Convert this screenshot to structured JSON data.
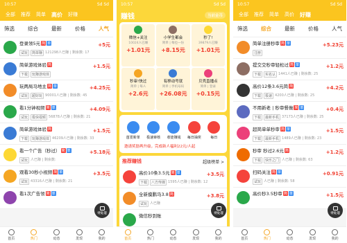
{
  "status": {
    "time": "10:57",
    "right": "Sd Sd"
  },
  "p1": {
    "tabs": [
      "全部",
      "推荐",
      "简单",
      "高价",
      "好赚"
    ],
    "active": 3,
    "filter": "筛选",
    "sub": [
      "综合",
      "最新",
      "价格",
      "人气"
    ],
    "subon": 3,
    "items": [
      {
        "t": "登录领5元",
        "b": [
          "简",
          "单"
        ],
        "tag": "试玩",
        "m": "简单赚",
        "s": "121298人已赚 | 剩余数: 17",
        "p": "+5元",
        "c": "#2aa84a"
      },
      {
        "t": "简单游戏体验",
        "b": [
          "简"
        ],
        "tag": "下载",
        "m": "玩赚游戏体",
        "s": "",
        "p": "+1.5元",
        "c": "#3a7bd5"
      },
      {
        "t": "玩两局马地主",
        "b": [
          "简",
          "单"
        ],
        "tag": "试玩",
        "m": "超好玩",
        "s": "90001人已赚 | 剩余数: 45",
        "p": "+4.25元",
        "c": "#f28c28"
      },
      {
        "t": "看1分钟视频",
        "b": [
          "简",
          "单"
        ],
        "tag": "试玩",
        "m": "极快视频",
        "s": "56878人已赚 | 剩余数: 21",
        "p": "+4.09元",
        "c": "#2aa84a"
      },
      {
        "t": "简单游戏体验",
        "b": [
          "简"
        ],
        "tag": "下载",
        "m": "玩赚游戏体",
        "s": "46209人已赚 | 剩余数: 33",
        "p": "+1.5元",
        "c": "#3a7bd5"
      },
      {
        "t": "看一个广告（秒过）",
        "b": [
          "简",
          "单"
        ],
        "tag": "试玩",
        "m": "",
        "s": "人已赚 | 剩余数:",
        "p": "+5.18元",
        "c": "#fdd835"
      },
      {
        "t": "观看30秒小视频",
        "b": [
          "简",
          "单"
        ],
        "tag": "试玩",
        "m": "",
        "s": "43316人已赚 | 剩余数: 21",
        "p": "+3.5元",
        "c": "#f5a623"
      },
      {
        "t": "看1次广告领",
        "b": [
          "简",
          "单"
        ],
        "tag": "",
        "m": "",
        "s": "",
        "p": "",
        "c": "#8e44ad"
      }
    ]
  },
  "p2": {
    "title": "赚钱",
    "gold": "当前金币",
    "grid": [
      {
        "t": "微信+关注",
        "m": "10024人已赚",
        "p": "+1.01元",
        "c": "#2aa84a"
      },
      {
        "t": "小学生都会",
        "m": "简单 | 每位一份",
        "p": "+8.15元",
        "c": "#8d6e63"
      },
      {
        "t": "秒了!",
        "m": "39879人已赚",
        "p": "+1.01元",
        "c": "#fdd835"
      },
      {
        "t": "秒审!快过",
        "m": "简单 | 每人",
        "p": "+2.6元",
        "c": "#f5a623"
      },
      {
        "t": "有移动号就",
        "m": "简单 | 手机号码",
        "p": "+26.08元",
        "c": "#3a7bd5"
      },
      {
        "t": "贝壳直播点",
        "m": "简单 | 登录",
        "p": "+0.15元",
        "c": "#ec407a"
      }
    ],
    "icons": [
      {
        "l": "首发新单",
        "c": "#3b8cf0"
      },
      {
        "l": "极速审核",
        "c": "#3b8cf0"
      },
      {
        "l": "收徒赚钱",
        "c": "#3b8cf0"
      },
      {
        "l": "每日抽奖",
        "c": "#f5433c"
      },
      {
        "l": "每日",
        "c": "#f5433c"
      }
    ],
    "notice": "邀请奖励再升级，完成新人福利22元/人起",
    "rec": "推荐赚钱",
    "super": "超级榜单 >",
    "items": [
      {
        "t": "高价10条3.5元",
        "b": [
          "简",
          "单"
        ],
        "tag": "下载",
        "m": "八方传媒",
        "s": "1595人已赚 | 剩余数: 12",
        "p": "+3.5元",
        "c": "#f5433c"
      },
      {
        "t": "全新摸鹏马3.8",
        "b": [
          "简"
        ],
        "tag": "试玩",
        "m": "",
        "s": "人已赚",
        "p": "+3.8元",
        "c": "#f28c28"
      },
      {
        "t": "微信秒到账",
        "b": [],
        "tag": "",
        "m": "",
        "s": "",
        "p": "",
        "c": "#2aa84a"
      }
    ]
  },
  "p3": {
    "sub": [
      "筛选",
      "综合",
      "最新",
      "价格",
      "人气"
    ],
    "subon": 1,
    "items": [
      {
        "t": "简单注册秒审",
        "b": [
          "简",
          "单"
        ],
        "tag": "注册",
        "m": "",
        "s": "",
        "p": "+5.23元",
        "c": "#f28c28"
      },
      {
        "t": "提交交秒审轻松过",
        "b": [
          "简",
          "单"
        ],
        "tag": "下载",
        "m": "实名认",
        "s": "1441人已赚 | 剩余数: 25",
        "p": "+1.2元",
        "c": "#8d6e63"
      },
      {
        "t": "高价12条3.6元简",
        "b": [
          "简"
        ],
        "tag": "下载",
        "m": "极速",
        "s": "4200人已赚 | 剩余数: 25",
        "p": "+4.2元",
        "c": "#333"
      },
      {
        "t": "不用新老 | 秒审餐做",
        "b": [
          "简",
          "单"
        ],
        "tag": "下载",
        "m": "最新手机",
        "s": "37173人已赚 | 剩余数: 25",
        "p": "+0.4元",
        "c": "#5c6bc0"
      },
      {
        "t": "超简单单秒审",
        "b": [
          "简",
          "单"
        ],
        "tag": "下载",
        "m": "最新手机",
        "s": "1489人已赚 | 剩余数: 23",
        "p": "+1.5元",
        "c": "#ec407a"
      },
      {
        "t": "秒审 秒过2.6元",
        "b": [
          "简"
        ],
        "tag": "下载",
        "m": "快乐之门",
        "s": "人已赚 | 剩余数: 63",
        "p": "+1.2元",
        "c": "#ef6c00"
      },
      {
        "t": "扫码关注",
        "b": [
          "简",
          "单"
        ],
        "tag": "试玩",
        "m": "",
        "s": "人已赚 | 剩余数: 58",
        "p": "+0.91元",
        "c": "#f5433c"
      },
      {
        "t": "高价秒3.5秒审",
        "b": [
          "简",
          "单"
        ],
        "tag": "",
        "m": "",
        "s": "",
        "p": "+1.5元",
        "c": "#2aa84a"
      }
    ]
  },
  "nav": [
    "首页",
    "热门",
    "动态",
    "发现",
    "我的"
  ],
  "pending": "待处理"
}
